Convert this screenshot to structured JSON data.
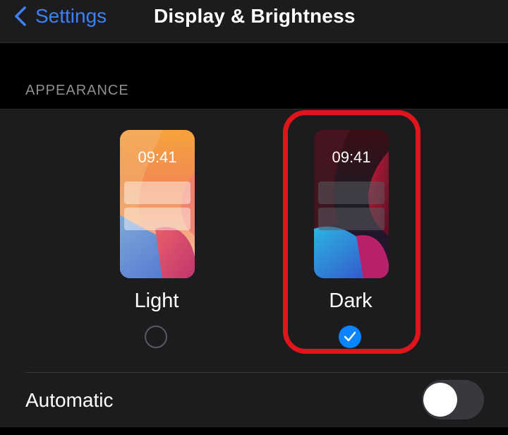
{
  "navbar": {
    "back_label": "Settings",
    "title": "Display & Brightness"
  },
  "appearance": {
    "section_header": "APPEARANCE",
    "options": [
      {
        "label": "Light",
        "preview_time": "09:41",
        "selected": false
      },
      {
        "label": "Dark",
        "preview_time": "09:41",
        "selected": true
      }
    ]
  },
  "automatic": {
    "label": "Automatic",
    "enabled": false
  },
  "colors": {
    "accent": "#0a84ff",
    "highlight": "#e0141b"
  },
  "icons": [
    "chevron-left-icon",
    "checkmark-icon"
  ]
}
